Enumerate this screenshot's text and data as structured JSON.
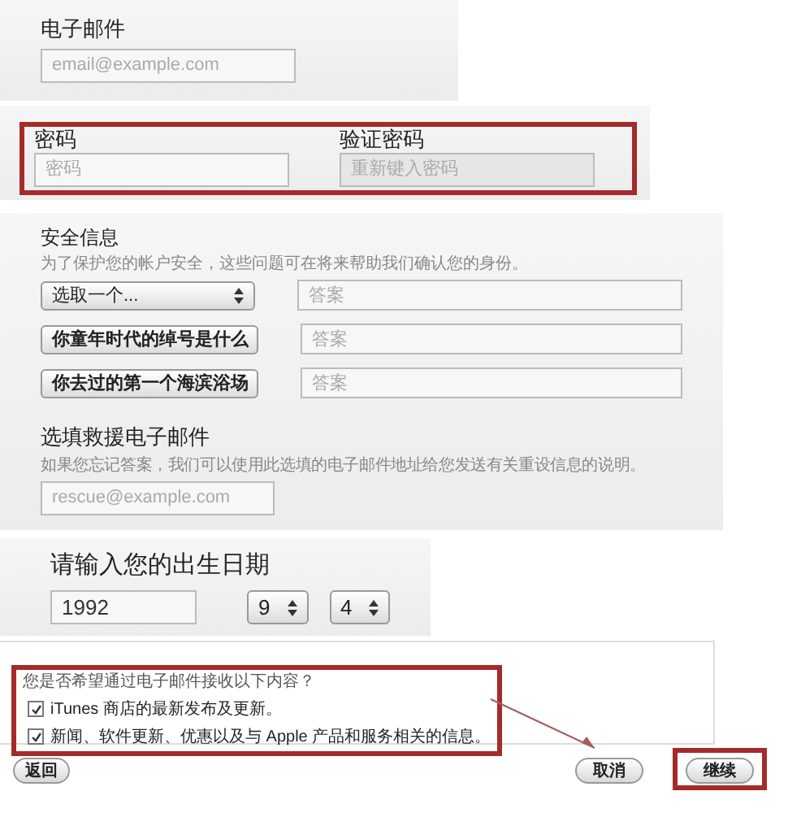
{
  "email": {
    "label": "电子邮件",
    "placeholder": "email@example.com"
  },
  "password": {
    "highlighted": true,
    "fields": [
      {
        "label": "密码",
        "placeholder": "密码",
        "disabled": false
      },
      {
        "label": "验证密码",
        "placeholder": "重新键入密码",
        "disabled": true
      }
    ]
  },
  "security": {
    "title": "安全信息",
    "description": "为了保护您的帐户安全，这些问题可在将来帮助我们确认您的身份。",
    "questions": [
      {
        "question": "选取一个...",
        "bold": false,
        "placeholder": "答案"
      },
      {
        "question": "你童年时代的绰号是什么",
        "bold": true,
        "placeholder": "答案"
      },
      {
        "question": "你去过的第一个海滨浴场",
        "bold": true,
        "placeholder": "答案"
      }
    ]
  },
  "rescue": {
    "title": "选填救援电子邮件",
    "description": "如果您忘记答案，我们可以使用此选填的电子邮件地址给您发送有关重设信息的说明。",
    "placeholder": "rescue@example.com"
  },
  "birthday": {
    "title": "请输入您的出生日期",
    "year": "1992",
    "month": "9",
    "day": "4"
  },
  "newsletter": {
    "highlighted": true,
    "question": "您是否希望通过电子邮件接收以下内容？",
    "options": [
      {
        "label": "iTunes 商店的最新发布及更新。",
        "checked": true
      },
      {
        "label": "新闻、软件更新、优惠以及与 Apple 产品和服务相关的信息。",
        "checked": true
      }
    ]
  },
  "buttons": [
    {
      "label": "返回",
      "kind": "back",
      "highlighted": false
    },
    {
      "label": "取消",
      "kind": "cancel",
      "highlighted": false
    },
    {
      "label": "继续",
      "kind": "continue",
      "highlighted": true
    }
  ]
}
